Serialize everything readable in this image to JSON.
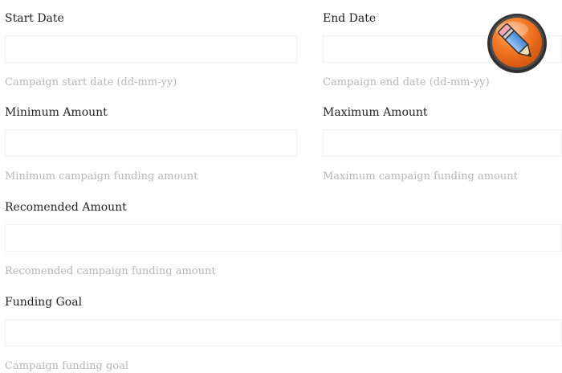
{
  "form": {
    "start_date": {
      "label": "Start Date",
      "value": "",
      "help": "Campaign start date (dd-mm-yy)"
    },
    "end_date": {
      "label": "End Date",
      "value": "",
      "help": "Campaign end date (dd-mm-yy)"
    },
    "minimum_amount": {
      "label": "Minimum Amount",
      "value": "",
      "help": "Minimum campaign funding amount"
    },
    "maximum_amount": {
      "label": "Maximum Amount",
      "value": "",
      "help": "Maximum campaign funding amount"
    },
    "recommended_amount": {
      "label": "Recomended Amount",
      "value": "",
      "help": "Recomended campaign funding amount"
    },
    "funding_goal": {
      "label": "Funding Goal",
      "value": "",
      "help": "Campaign funding goal"
    }
  },
  "edit_badge": {
    "icon": "pencil-icon",
    "colors": {
      "badge_orange": "#f26a1b",
      "badge_dark": "#3a3a3a",
      "pencil_body": "#5aa0e6"
    }
  },
  "colors": {
    "label_text": "#222222",
    "help_text": "#b7b7b7",
    "input_border": "#f1f1f1"
  }
}
